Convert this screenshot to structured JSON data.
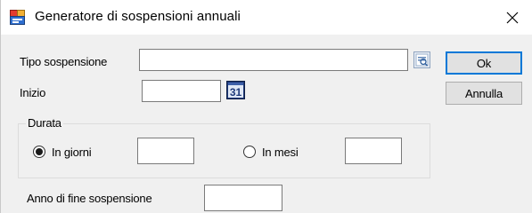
{
  "window": {
    "title": "Generatore di sospensioni annuali"
  },
  "icons": {
    "app": "form-window-icon",
    "close": "close-icon",
    "lookup": "lookup-icon",
    "calendar": "calendar-icon"
  },
  "form": {
    "tipo_label": "Tipo sospensione",
    "tipo_value": "",
    "inizio_label": "Inizio",
    "inizio_value": "",
    "calendar_day": "31",
    "durata_label": "Durata",
    "giorni_label": "In giorni",
    "giorni_value": "",
    "giorni_checked": true,
    "mesi_label": "In mesi",
    "mesi_value": "",
    "mesi_checked": false,
    "anno_label": "Anno di fine sospensione",
    "anno_value": ""
  },
  "buttons": {
    "ok": "Ok",
    "cancel": "Annulla"
  },
  "colors": {
    "default_button_border": "#0078d7",
    "calendar_blue": "#1f3a7a"
  }
}
